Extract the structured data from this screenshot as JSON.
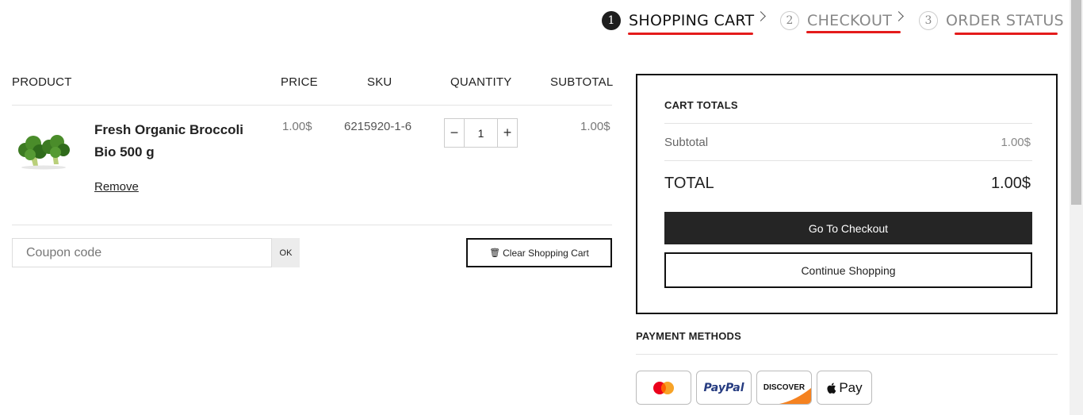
{
  "steps": [
    {
      "num": "1",
      "label": "SHOPPING CART"
    },
    {
      "num": "2",
      "label": "CHECKOUT"
    },
    {
      "num": "3",
      "label": "ORDER STATUS"
    }
  ],
  "table": {
    "headers": {
      "product": "PRODUCT",
      "price": "PRICE",
      "sku": "SKU",
      "quantity": "QUANTITY",
      "subtotal": "SUBTOTAL"
    }
  },
  "item": {
    "image_icon": "broccoli-image",
    "name": "Fresh Organic Broccoli Bio 500 g",
    "price": "1.00$",
    "sku": "6215920-1-6",
    "quantity": "1",
    "subtotal": "1.00$",
    "remove_label": "Remove"
  },
  "coupon": {
    "placeholder": "Coupon code",
    "ok_label": "OK"
  },
  "clear_cart_label": "Clear Shopping Cart",
  "totals": {
    "title": "CART TOTALS",
    "subtotal_label": "Subtotal",
    "subtotal_value": "1.00$",
    "total_label": "TOTAL",
    "total_value": "1.00$",
    "checkout_label": "Go To Checkout",
    "continue_label": "Continue Shopping"
  },
  "payment": {
    "title": "PAYMENT METHODS",
    "methods": [
      "mastercard-icon",
      "paypal-icon",
      "discover-icon",
      "apple-pay-icon"
    ],
    "paypal_text": "PayPal",
    "discover_text": "DISCOVER",
    "applepay_text": "Pay"
  },
  "colors": {
    "accent_underline": "#e41b1b",
    "dark": "#252525"
  }
}
